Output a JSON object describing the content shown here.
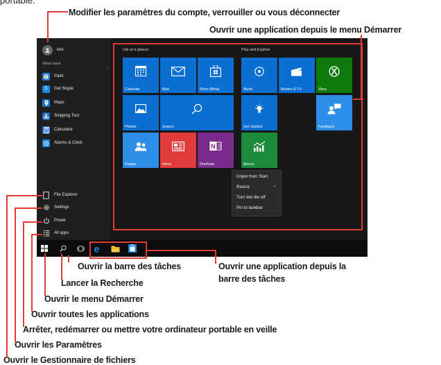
{
  "intro_fragment": "portable.",
  "callouts": {
    "account": "Modifier les paramètres du compte, verrouiller ou vous déconnecter",
    "open_app_start": "Ouvrir une application depuis le menu Démarrer",
    "taskbar": "Ouvrir la barre des tâches",
    "open_app_taskbar_1": "Ouvrir une application depuis la",
    "open_app_taskbar_2": "barre des tâches",
    "search": "Lancer la Recherche",
    "start": "Ouvrir le menu Démarrer",
    "all_apps": "Ouvrir toutes les applications",
    "power": "Arrêter, redémarrer ou mettre votre ordinateur portable en veille",
    "settings": "Ouvrir les Paramètres",
    "file_explorer": "Ouvrir le Gestionnaire de fichiers"
  },
  "start_menu": {
    "user_name": "test",
    "most_used_label": "Most used",
    "most_used": [
      {
        "label": "Paint",
        "icon": "paint-icon",
        "color": "#2d7fd3"
      },
      {
        "label": "Get Skype",
        "icon": "skype-icon",
        "color": "#1e88e5"
      },
      {
        "label": "Maps",
        "icon": "maps-icon",
        "color": "#1976d2"
      },
      {
        "label": "Snipping Tool",
        "icon": "snipping-tool-icon",
        "color": "#1565c0"
      },
      {
        "label": "Calculator",
        "icon": "calculator-icon",
        "color": "#1e6ed8"
      },
      {
        "label": "Alarms & Clock",
        "icon": "alarm-clock-icon",
        "color": "#1e88e5"
      }
    ],
    "system": {
      "file_explorer": "File Explorer",
      "settings": "Settings",
      "power": "Power",
      "all_apps": "All apps"
    },
    "groups": {
      "life": "Life at a glance",
      "play": "Play and Explore"
    },
    "tiles": {
      "calendar": "Calendar",
      "mail": "Mail",
      "store": "Store (Beta)",
      "photos": "Photos",
      "search": "Search",
      "people": "People",
      "news": "News",
      "onenote": "OneNote",
      "music": "Music",
      "movies": "Movies & TV",
      "xbox": "Xbox",
      "feedback": "Feedback",
      "get_started": "Get Started",
      "money": "Money"
    },
    "context_menu": {
      "unpin": "Unpin from Start",
      "resize": "Resize",
      "live_tile": "Turn live tile off",
      "pin_taskbar": "Pin to taskbar"
    }
  },
  "colors": {
    "accent_blue": "#0a6fd0",
    "highlight_red": "#e53935",
    "news_red": "#e03a3a",
    "onenote_purple": "#7b2a8e",
    "xbox_green": "#0e7a0d",
    "money_green": "#1b8a3a"
  }
}
